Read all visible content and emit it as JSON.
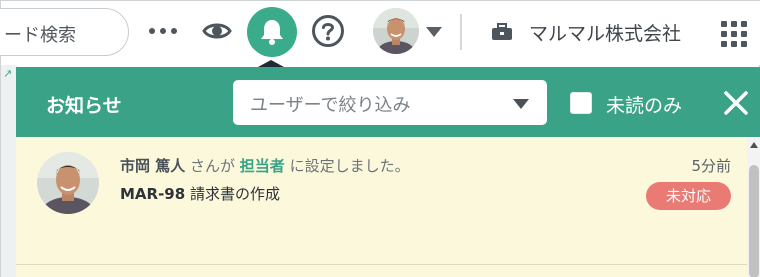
{
  "header": {
    "search_text": "ード検索",
    "org_name": "マルマル株式会社"
  },
  "icons": {
    "more": "more-dots-icon",
    "eye": "eye-icon",
    "bell": "bell-icon",
    "help": "help-icon",
    "org": "briefcase-icon",
    "apps": "apps-grid-icon",
    "close": "close-icon"
  },
  "colors": {
    "accent": "#3aa287",
    "panel_bg": "#fbf8dc",
    "badge": "#ea7a74"
  },
  "panel": {
    "title": "お知らせ",
    "user_filter_placeholder": "ユーザーで絞り込み",
    "unread_label": "未読のみ",
    "unread_checked": false
  },
  "notifications": [
    {
      "actor": "市岡 篤人",
      "text_after_actor": " さんが ",
      "field": "担当者",
      "text_after_field": " に設定しました。",
      "issue_key": "MAR-98",
      "issue_title": " 請求書の作成",
      "time": "5分前",
      "status": "未対応"
    }
  ]
}
